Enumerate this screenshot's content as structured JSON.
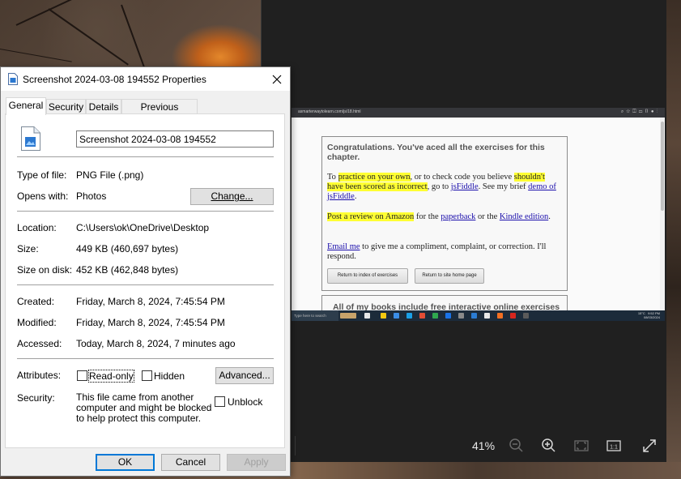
{
  "dialog": {
    "title": "Screenshot 2024-03-08 194552 Properties",
    "tabs": [
      {
        "label": "General"
      },
      {
        "label": "Security"
      },
      {
        "label": "Details"
      },
      {
        "label": "Previous Versions"
      }
    ],
    "file_name": "Screenshot 2024-03-08 194552",
    "type_of_file": {
      "label": "Type of file:",
      "value": "PNG File (.png)"
    },
    "opens_with": {
      "label": "Opens with:",
      "value": "Photos",
      "button": "Change..."
    },
    "location": {
      "label": "Location:",
      "value": "C:\\Users\\ok\\OneDrive\\Desktop"
    },
    "size": {
      "label": "Size:",
      "value": "449 KB (460,697 bytes)"
    },
    "size_on_disk": {
      "label": "Size on disk:",
      "value": "452 KB (462,848 bytes)"
    },
    "created": {
      "label": "Created:",
      "value": "Friday, March 8, 2024, 7:45:54 PM"
    },
    "modified": {
      "label": "Modified:",
      "value": "Friday, March 8, 2024, 7:45:54 PM"
    },
    "accessed": {
      "label": "Accessed:",
      "value": "Today, March 8, 2024, 7 minutes ago"
    },
    "attributes": {
      "label": "Attributes:",
      "read_only": "Read-only",
      "hidden": "Hidden",
      "advanced": "Advanced...",
      "read_only_checked": false,
      "hidden_checked": false
    },
    "security": {
      "label": "Security:",
      "text": "This file came from another computer and might be blocked to help protect this computer.",
      "unblock": "Unblock",
      "unblock_checked": false
    },
    "buttons": {
      "ok": "OK",
      "cancel": "Cancel",
      "apply": "Apply"
    }
  },
  "viewer": {
    "zoom": "41%",
    "inner_url": "asmarterwaytolearn.com/js/18.html",
    "inner_page": {
      "heading": "Congratulations. You've aced all the exercises for this chapter.",
      "p1_a": "To ",
      "p1_hl1": "practice on your own",
      "p1_b": ", or to check code you believe ",
      "p1_hl2": "shouldn't have been scored as incorrect",
      "p1_c": ", go to ",
      "p1_link1": "jsFiddle",
      "p1_d": ". See my brief ",
      "p1_link2": "demo of jsFiddle",
      "p1_e": ".",
      "p2_hl": "Post a review on Amazon",
      "p2_a": " for the ",
      "p2_link1": "paperback",
      "p2_b": " or the ",
      "p2_link2": "Kindle edition",
      "p2_c": ".",
      "p3_link": "Email me",
      "p3_a": " to give me a compliment, complaint, or correction. I'll respond.",
      "btn_index": "Return to index of exercises",
      "btn_home": "Return to site home page",
      "card2_text": "All of my books include free interactive online exercises that make the knowledge stick",
      "taskbar_search": "Type here to search",
      "tray_temp": "15°C",
      "tray_time": "9:52 PM",
      "tray_date": "08/03/2024"
    }
  },
  "colors": {
    "accent": "#0078d7",
    "highlight": "#ffff33",
    "viewer_bg": "#202020"
  }
}
